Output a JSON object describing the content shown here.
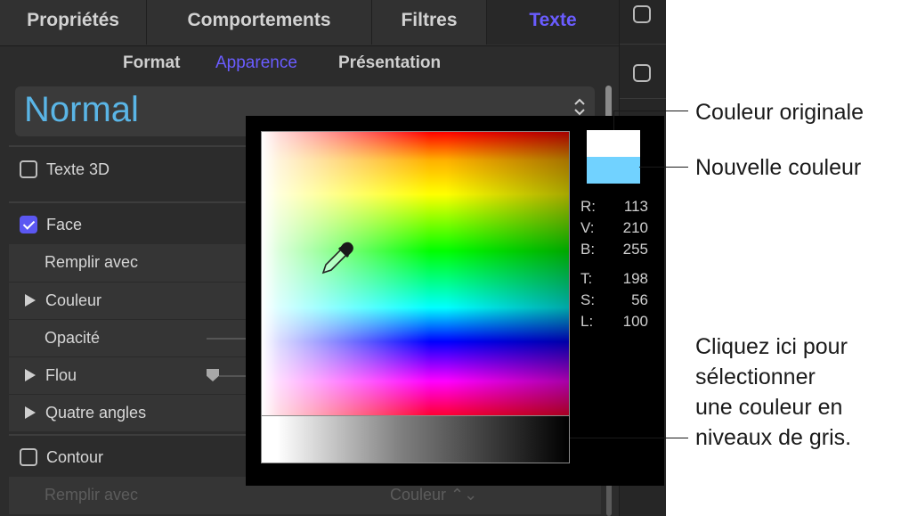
{
  "tabs": [
    {
      "label": "Propriétés"
    },
    {
      "label": "Comportements"
    },
    {
      "label": "Filtres"
    },
    {
      "label": "Texte"
    }
  ],
  "subtabs": [
    {
      "label": "Format"
    },
    {
      "label": "Apparence"
    },
    {
      "label": "Présentation"
    }
  ],
  "preset": {
    "label": "Normal",
    "arrows": "⌃⌄"
  },
  "rows": {
    "text3d": "Texte 3D",
    "face": "Face",
    "fill_with": "Remplir avec",
    "color": "Couleur",
    "opacity": "Opacité",
    "blur": "Flou",
    "four_corners": "Quatre angles",
    "outline": "Contour",
    "outline_fill_with": "Remplir avec",
    "outline_fill_value": "Couleur ⌃⌄"
  },
  "picker": {
    "rgb": [
      {
        "key": "R:",
        "value": "113"
      },
      {
        "key": "V:",
        "value": "210"
      },
      {
        "key": "B:",
        "value": "255"
      }
    ],
    "hsl": [
      {
        "key": "T:",
        "value": "198"
      },
      {
        "key": "S:",
        "value": "56"
      },
      {
        "key": "L:",
        "value": "100"
      }
    ],
    "original_color": "#ffffff",
    "new_color": "#71d2ff"
  },
  "callouts": {
    "original": "Couleur originale",
    "new": "Nouvelle couleur",
    "grayscale_lines": [
      "Cliquez ici pour",
      "sélectionner",
      "une couleur en",
      "niveaux de gris."
    ]
  },
  "colors": {
    "accent": "#6a5cff",
    "preset_text": "#5ab5e6",
    "panel_bg": "#2c2c2c"
  }
}
